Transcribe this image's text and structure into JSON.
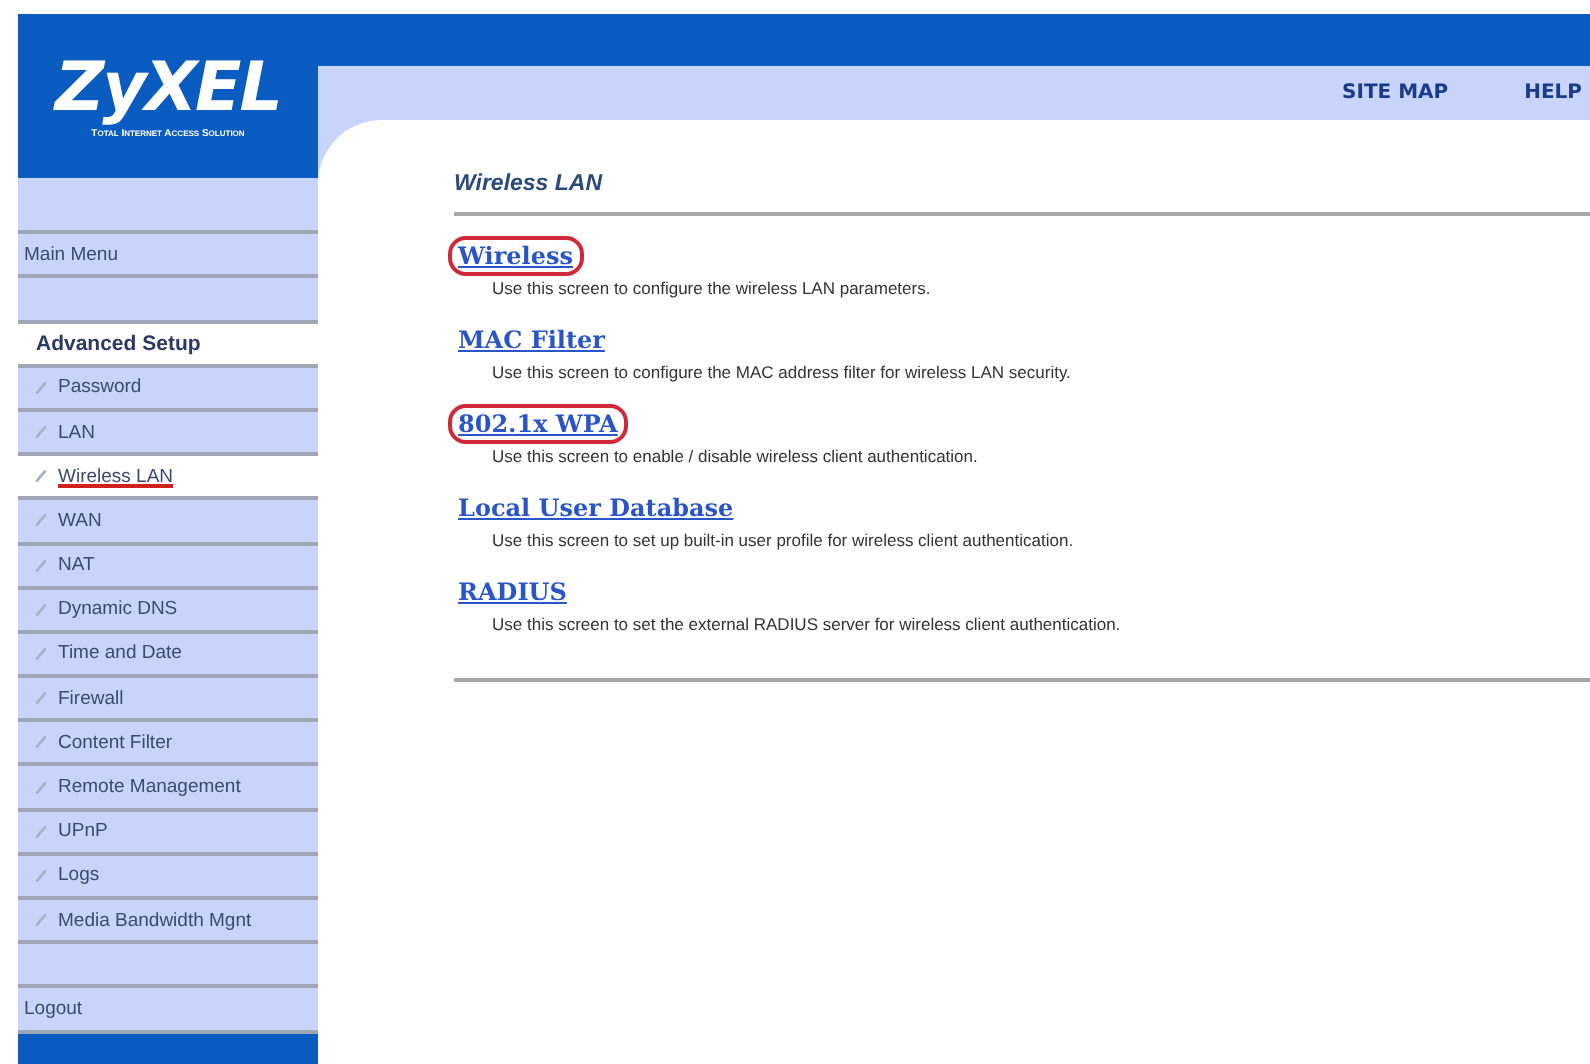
{
  "logo": {
    "brand": "ZyXEL",
    "tagline": "Total Internet Access Solution"
  },
  "header": {
    "links": [
      "SITE MAP",
      "HELP"
    ]
  },
  "sidebar": {
    "items": [
      {
        "kind": "spacer"
      },
      {
        "kind": "link",
        "label": "Main Menu",
        "selected": false
      },
      {
        "kind": "spacer"
      },
      {
        "kind": "section",
        "label": "Advanced Setup"
      },
      {
        "kind": "subitem",
        "label": "Password",
        "selected": false
      },
      {
        "kind": "subitem",
        "label": "LAN",
        "selected": false
      },
      {
        "kind": "subitem",
        "label": "Wireless LAN",
        "selected": true
      },
      {
        "kind": "subitem",
        "label": "WAN",
        "selected": false
      },
      {
        "kind": "subitem",
        "label": "NAT",
        "selected": false
      },
      {
        "kind": "subitem",
        "label": "Dynamic DNS",
        "selected": false
      },
      {
        "kind": "subitem",
        "label": "Time and Date",
        "selected": false
      },
      {
        "kind": "subitem",
        "label": "Firewall",
        "selected": false
      },
      {
        "kind": "subitem",
        "label": "Content Filter",
        "selected": false
      },
      {
        "kind": "subitem",
        "label": "Remote Management",
        "selected": false
      },
      {
        "kind": "subitem",
        "label": "UPnP",
        "selected": false
      },
      {
        "kind": "subitem",
        "label": "Logs",
        "selected": false
      },
      {
        "kind": "subitem",
        "label": "Media Bandwidth Mgnt",
        "selected": false
      },
      {
        "kind": "spacer"
      },
      {
        "kind": "link",
        "label": "Logout",
        "selected": false
      }
    ]
  },
  "content": {
    "title": "Wireless LAN",
    "entries": [
      {
        "link": "Wireless",
        "description": "Use this screen to configure the wireless LAN parameters.",
        "highlighted": true
      },
      {
        "link": "MAC Filter",
        "description": "Use this screen to configure the MAC address filter for wireless LAN security.",
        "highlighted": false
      },
      {
        "link": "802.1x WPA",
        "description": "Use this screen to enable / disable wireless client authentication.",
        "highlighted": true
      },
      {
        "link": "Local User Database",
        "description": "Use this screen to set up built-in user profile for wireless client authentication.",
        "highlighted": false
      },
      {
        "link": "RADIUS",
        "description": "Use this screen to set the external RADIUS server for wireless client authentication.",
        "highlighted": false
      }
    ]
  }
}
